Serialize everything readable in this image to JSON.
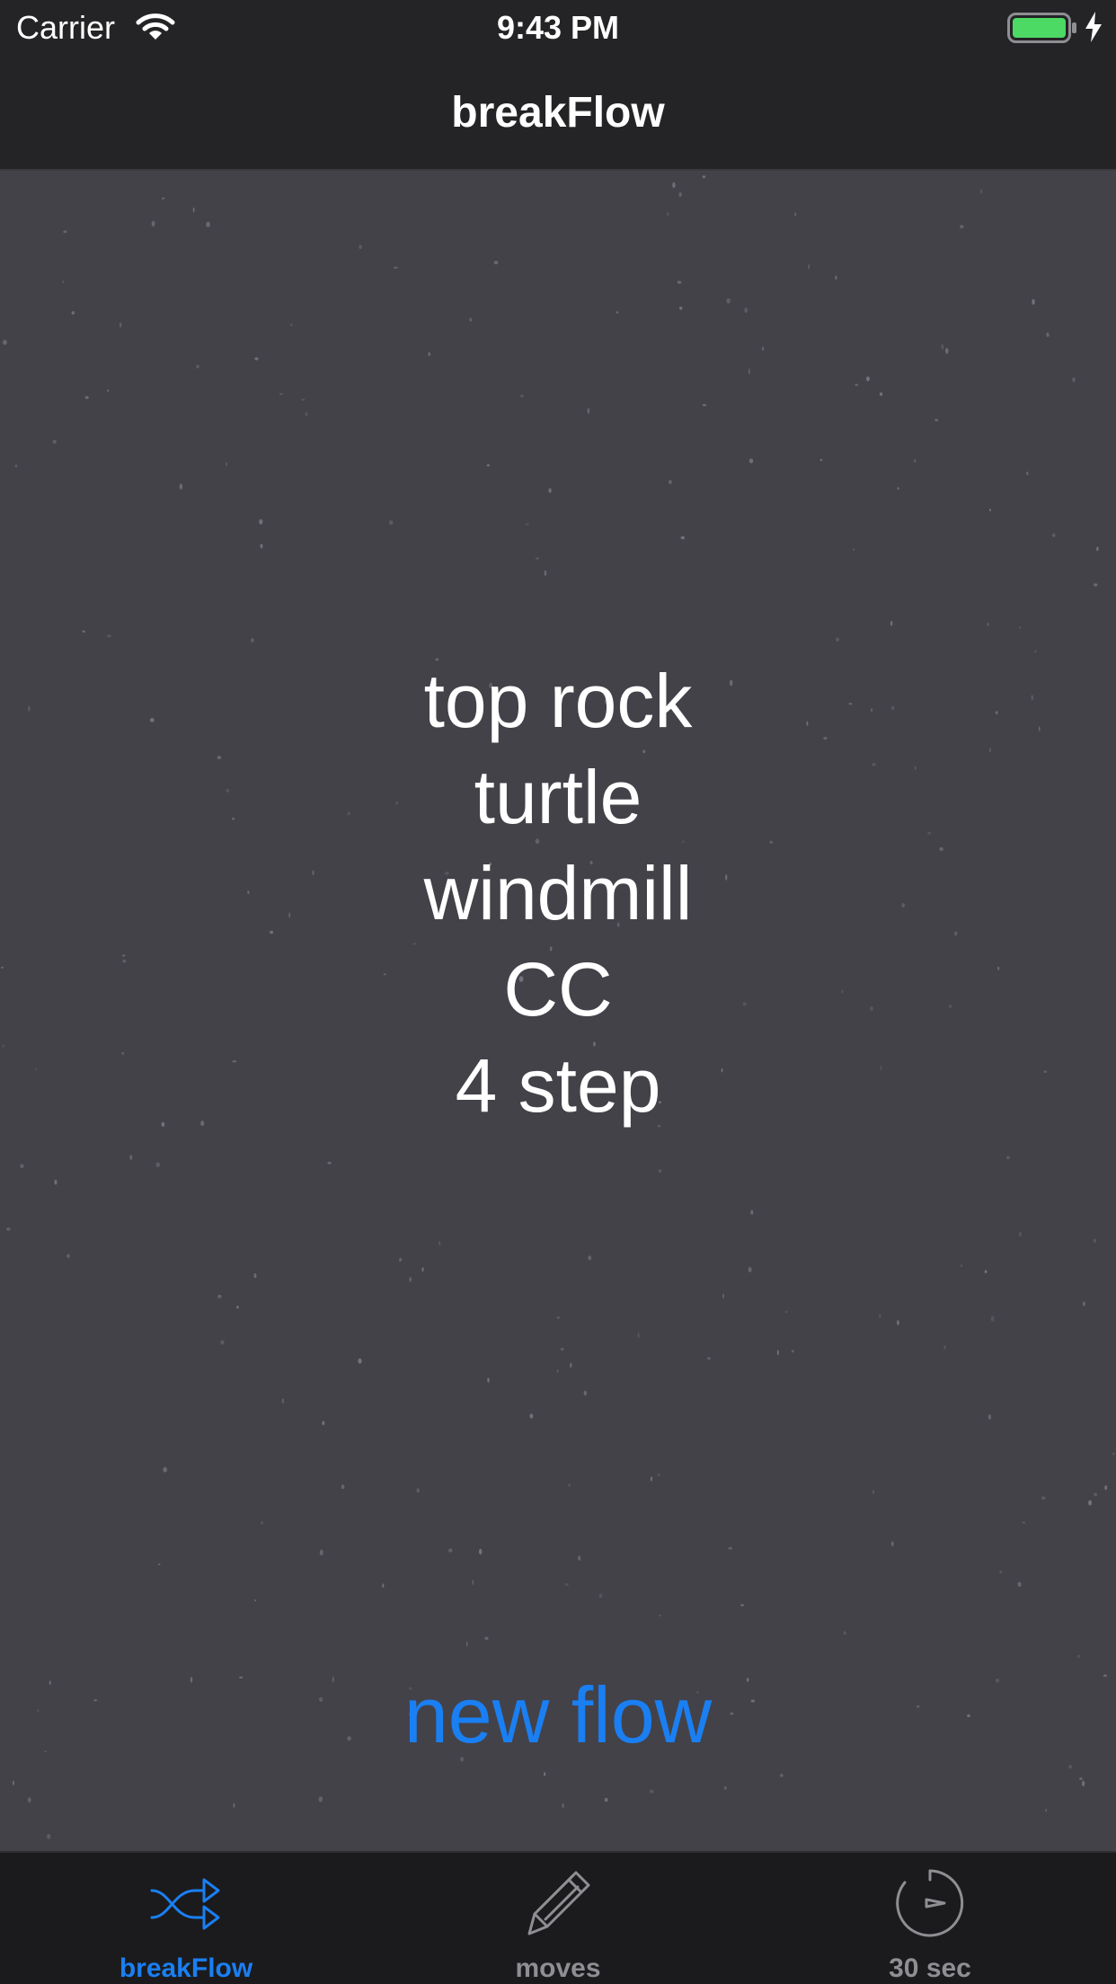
{
  "status_bar": {
    "carrier": "Carrier",
    "time": "9:43 PM",
    "battery_color": "#4cd964"
  },
  "nav": {
    "title": "breakFlow"
  },
  "flow": {
    "moves": [
      "top rock",
      "turtle",
      "windmill",
      "CC",
      "4 step"
    ]
  },
  "actions": {
    "new_flow_label": "new flow"
  },
  "tabs": [
    {
      "label": "breakFlow",
      "icon": "shuffle-icon",
      "selected": true
    },
    {
      "label": "moves",
      "icon": "pencil-icon",
      "selected": false
    },
    {
      "label": "30 sec",
      "icon": "timer-icon",
      "selected": false
    }
  ],
  "colors": {
    "accent": "#1a7ff2",
    "inactive_tab": "#8e8e93",
    "content_background": "#434249",
    "bar_background": "#242426"
  }
}
